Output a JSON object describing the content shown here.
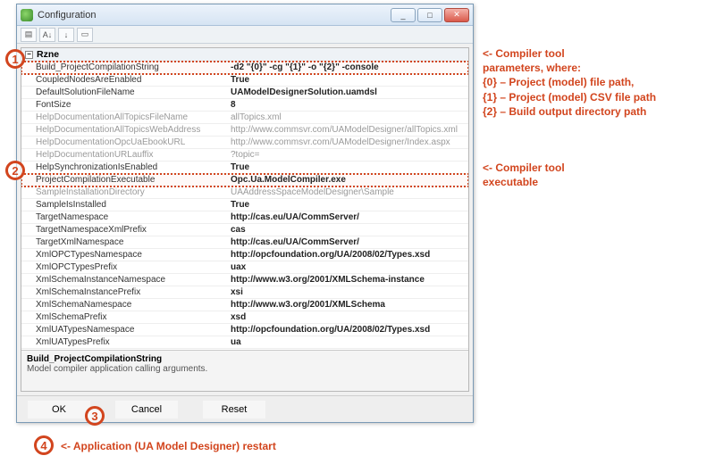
{
  "window": {
    "title": "Configuration",
    "min_label": "_",
    "max_label": "□",
    "close_label": "✕"
  },
  "toolbar": {
    "icons": [
      "categorized-icon",
      "alpha-sort-icon",
      "down-arrow-icon",
      "props-page-icon"
    ]
  },
  "category": {
    "name": "Rzne"
  },
  "properties": [
    {
      "key": "Build_ProjectCompilationString",
      "val": "-d2 \"{0}\" -cg \"{1}\" -o \"{2}\" -console",
      "dim": false,
      "hl": "hl1"
    },
    {
      "key": "CoupledNodesAreEnabled",
      "val": "True",
      "dim": false
    },
    {
      "key": "DefaultSolutionFileName",
      "val": "UAModelDesignerSolution.uamdsl",
      "dim": false
    },
    {
      "key": "FontSize",
      "val": "8",
      "dim": false
    },
    {
      "key": "HelpDocumentationAllTopicsFileName",
      "val": "allTopics.xml",
      "dim": true
    },
    {
      "key": "HelpDocumentationAllTopicsWebAddress",
      "val": "http://www.commsvr.com/UAModelDesigner/allTopics.xml",
      "dim": true
    },
    {
      "key": "HelpDocumentationOpcUaEbookURL",
      "val": "http://www.commsvr.com/UAModelDesigner/Index.aspx",
      "dim": true
    },
    {
      "key": "HelpDocumentationURLauffix",
      "val": "?topic=",
      "dim": true
    },
    {
      "key": "HelpSynchronizationIsEnabled",
      "val": "True",
      "dim": false
    },
    {
      "key": "ProjectCompilationExecutable",
      "val": "Opc.Ua.ModelCompiler.exe",
      "dim": false,
      "hl": "hl2"
    },
    {
      "key": "SampleInstallationDirectory",
      "val": "UAAddressSpaceModelDesigner\\Sample",
      "dim": true
    },
    {
      "key": "SampleIsInstalled",
      "val": "True",
      "dim": false
    },
    {
      "key": "TargetNamespace",
      "val": "http://cas.eu/UA/CommServer/",
      "dim": false
    },
    {
      "key": "TargetNamespaceXmlPrefix",
      "val": "cas",
      "dim": false
    },
    {
      "key": "TargetXmlNamespace",
      "val": "http://cas.eu/UA/CommServer/",
      "dim": false
    },
    {
      "key": "XmlOPCTypesNamespace",
      "val": "http://opcfoundation.org/UA/2008/02/Types.xsd",
      "dim": false
    },
    {
      "key": "XmlOPCTypesPrefix",
      "val": "uax",
      "dim": false
    },
    {
      "key": "XmlSchemaInstanceNamespace",
      "val": "http://www.w3.org/2001/XMLSchema-instance",
      "dim": false
    },
    {
      "key": "XmlSchemaInstancePrefix",
      "val": "xsi",
      "dim": false
    },
    {
      "key": "XmlSchemaNamespace",
      "val": "http://www.w3.org/2001/XMLSchema",
      "dim": false
    },
    {
      "key": "XmlSchemaPrefix",
      "val": "xsd",
      "dim": false
    },
    {
      "key": "XmlUATypesNamespace",
      "val": "http://opcfoundation.org/UA/2008/02/Types.xsd",
      "dim": false
    },
    {
      "key": "XmlUATypesPrefix",
      "val": "ua",
      "dim": false
    }
  ],
  "description": {
    "title": "Build_ProjectCompilationString",
    "text": "Model compiler application calling arguments."
  },
  "buttons": {
    "ok": "OK",
    "cancel": "Cancel",
    "reset": "Reset"
  },
  "annotations": {
    "a1_lines": [
      "<- Compiler tool",
      "parameters, where:",
      "{0} – Project (model) file path,",
      "{1} – Project (model) CSV file path",
      "{2} – Build output directory path"
    ],
    "a2_lines": [
      "<- Compiler tool",
      "executable"
    ],
    "a4": "<- Application (UA Model Designer) restart",
    "n1": "1",
    "n2": "2",
    "n3": "3",
    "n4": "4"
  }
}
